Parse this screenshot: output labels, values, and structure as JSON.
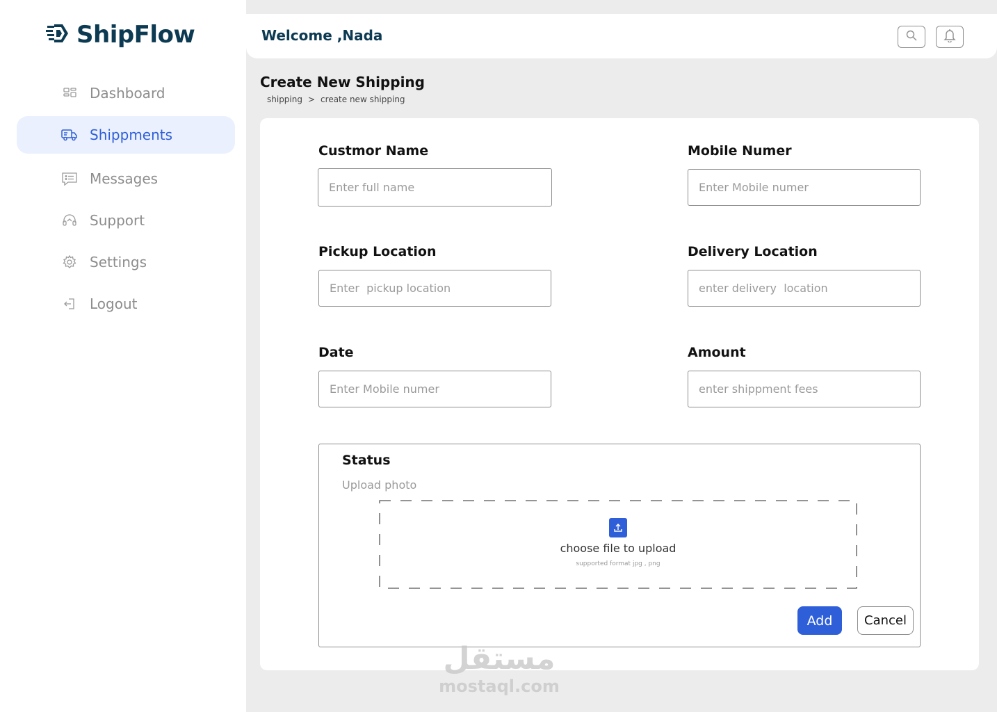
{
  "brand": {
    "name": "ShipFlow",
    "color": "#0c3a52",
    "accent": "#2f5fd8"
  },
  "sidebar": {
    "items": [
      {
        "label": "Dashboard",
        "icon": "dashboard-grid-icon",
        "active": false
      },
      {
        "label": "Shippments",
        "icon": "truck-icon",
        "active": true
      },
      {
        "label": "Messages",
        "icon": "message-icon",
        "active": false
      },
      {
        "label": "Support",
        "icon": "headset-icon",
        "active": false
      },
      {
        "label": "Settings",
        "icon": "gear-icon",
        "active": false
      },
      {
        "label": "Logout",
        "icon": "logout-icon",
        "active": false
      }
    ]
  },
  "header": {
    "welcome": "Welcome ,Nada",
    "icons": [
      "search-icon",
      "bell-icon"
    ]
  },
  "page": {
    "title": "Create New Shipping",
    "breadcrumb": [
      "shipping",
      ">",
      "create new shipping"
    ]
  },
  "form": {
    "customer_name": {
      "label": "Custmor Name",
      "placeholder": "Enter full name"
    },
    "mobile": {
      "label": "Mobile Numer",
      "placeholder": "Enter Mobile numer"
    },
    "pickup": {
      "label": "Pickup Location",
      "placeholder": "Enter  pickup location"
    },
    "delivery": {
      "label": "Delivery Location",
      "placeholder": "enter delivery  location"
    },
    "date": {
      "label": "Date",
      "placeholder": "Enter Mobile numer"
    },
    "amount": {
      "label": "Amount",
      "placeholder": "enter shippment fees"
    },
    "status": {
      "title": "Status",
      "upload_label": "Upload photo",
      "drop_text": "choose file to upload",
      "drop_sub": "supported format jpg , png",
      "icon": "upload-icon"
    },
    "add_label": "Add",
    "cancel_label": "Cancel"
  },
  "watermark": {
    "arabic": "مستقل",
    "latin": "mostaql.com"
  }
}
